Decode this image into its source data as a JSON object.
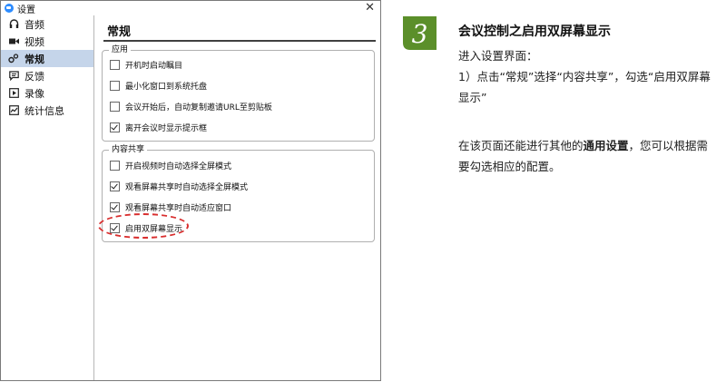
{
  "window": {
    "title": "设置",
    "close_glyph": "✕"
  },
  "sidebar": {
    "items": [
      {
        "label": "音频",
        "icon": "headphones-icon",
        "active": false
      },
      {
        "label": "视频",
        "icon": "camera-icon",
        "active": false
      },
      {
        "label": "常规",
        "icon": "gear-icon",
        "active": true
      },
      {
        "label": "反馈",
        "icon": "comment-icon",
        "active": false
      },
      {
        "label": "录像",
        "icon": "record-icon",
        "active": false
      },
      {
        "label": "统计信息",
        "icon": "chart-icon",
        "active": false
      }
    ]
  },
  "main": {
    "title": "常规",
    "groups": [
      {
        "label": "应用",
        "options": [
          {
            "label": "开机时启动瞩目",
            "checked": false
          },
          {
            "label": "最小化窗口到系统托盘",
            "checked": false
          },
          {
            "label": "会议开始后，自动复制邀请URL至剪贴板",
            "checked": false
          },
          {
            "label": "离开会议时显示提示框",
            "checked": true
          }
        ]
      },
      {
        "label": "内容共享",
        "options": [
          {
            "label": "开启视频时自动选择全屏模式",
            "checked": false
          },
          {
            "label": "观看屏幕共享时自动选择全屏模式",
            "checked": true
          },
          {
            "label": "观看屏幕共享时自动适应窗口",
            "checked": true
          },
          {
            "label": "启用双屏幕显示",
            "checked": true
          }
        ]
      }
    ]
  },
  "guide": {
    "step_number": "3",
    "heading": "会议控制之启用双屏幕显示",
    "line1": "进入设置界面：",
    "line2": "1）点击“常规”选择“内容共享”，勾选“启用双屏幕显示”",
    "line3_pre": "在该页面还能进行其他的",
    "line3_bold": "通用设置",
    "line3_post": "，您可以根据需要勾选相应的配置。"
  },
  "colors": {
    "sidebar_active": "#c5d5ea",
    "badge_green": "#5b8f2a",
    "highlight_red": "#d92e2e"
  }
}
